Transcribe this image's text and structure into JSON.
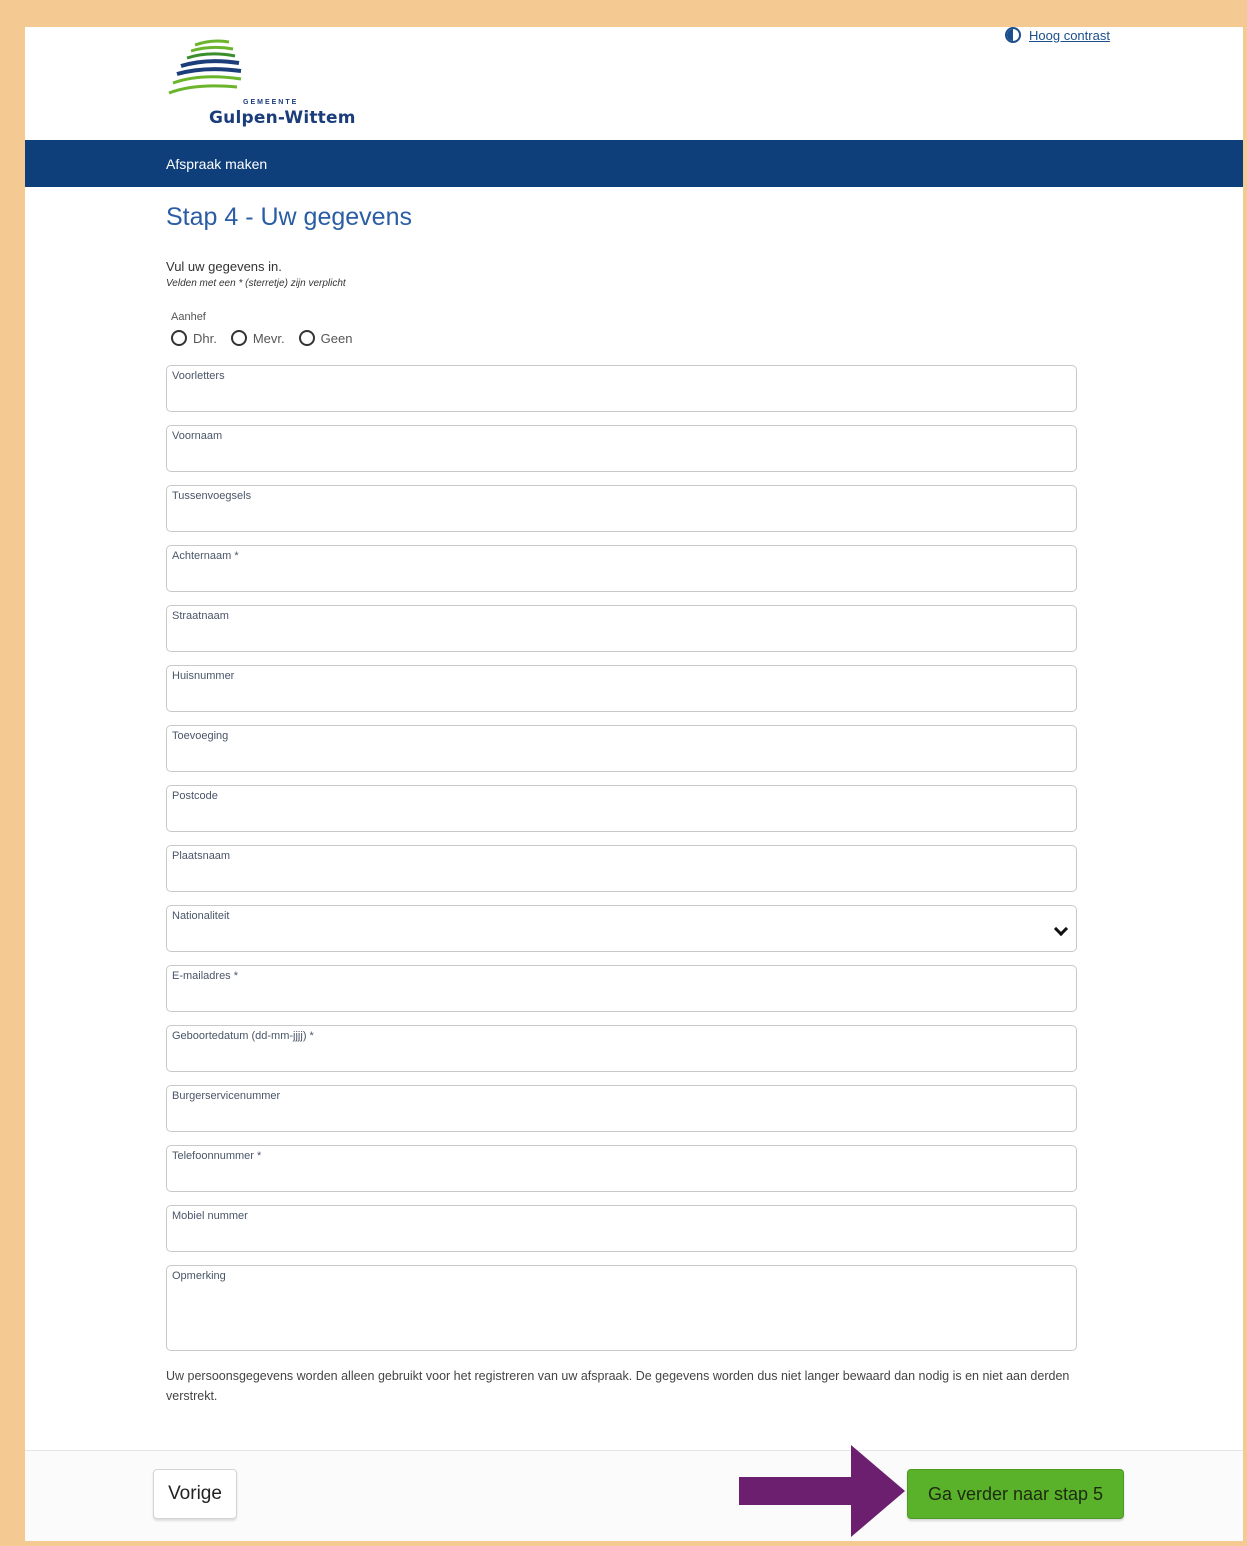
{
  "header": {
    "logo_small": "GEMEENTE",
    "logo_name": "Gulpen-Wittem",
    "contrast_link": "Hoog contrast"
  },
  "nav": {
    "title": "Afspraak maken"
  },
  "step": {
    "title": "Stap 4 - Uw gegevens",
    "intro": "Vul uw gegevens in.",
    "required_note": "Velden met een * (sterretje) zijn verplicht"
  },
  "aanhef": {
    "label": "Aanhef",
    "options": [
      "Dhr.",
      "Mevr.",
      "Geen"
    ]
  },
  "fields": {
    "voorletters": {
      "label": "Voorletters",
      "value": ""
    },
    "voornaam": {
      "label": "Voornaam",
      "value": ""
    },
    "tussenvoegsels": {
      "label": "Tussenvoegsels",
      "value": ""
    },
    "achternaam": {
      "label": "Achternaam *",
      "value": ""
    },
    "straatnaam": {
      "label": "Straatnaam",
      "value": ""
    },
    "huisnummer": {
      "label": "Huisnummer",
      "value": ""
    },
    "toevoeging": {
      "label": "Toevoeging",
      "value": ""
    },
    "postcode": {
      "label": "Postcode",
      "value": ""
    },
    "plaatsnaam": {
      "label": "Plaatsnaam",
      "value": ""
    },
    "nationaliteit": {
      "label": "Nationaliteit",
      "value": ""
    },
    "email": {
      "label": "E-mailadres *",
      "value": ""
    },
    "geboortedatum": {
      "label": "Geboortedatum (dd-mm-jjjj) *",
      "value": ""
    },
    "bsn": {
      "label": "Burgerservicenummer",
      "value": ""
    },
    "telefoon": {
      "label": "Telefoonnummer *",
      "value": ""
    },
    "mobiel": {
      "label": "Mobiel nummer",
      "value": ""
    },
    "opmerking": {
      "label": "Opmerking",
      "value": ""
    }
  },
  "privacy_text": "Uw persoonsgegevens worden alleen gebruikt voor het registreren van uw afspraak. De gegevens worden dus niet langer bewaard dan nodig is en niet aan derden verstrekt.",
  "footer": {
    "prev_label": "Vorige",
    "next_label": "Ga verder naar stap 5"
  },
  "colors": {
    "frame_border": "#f5c992",
    "nav_bg": "#0f3f7a",
    "title_blue": "#2a5da3",
    "next_button": "#5ab12a",
    "arrow": "#6b1f6e"
  }
}
